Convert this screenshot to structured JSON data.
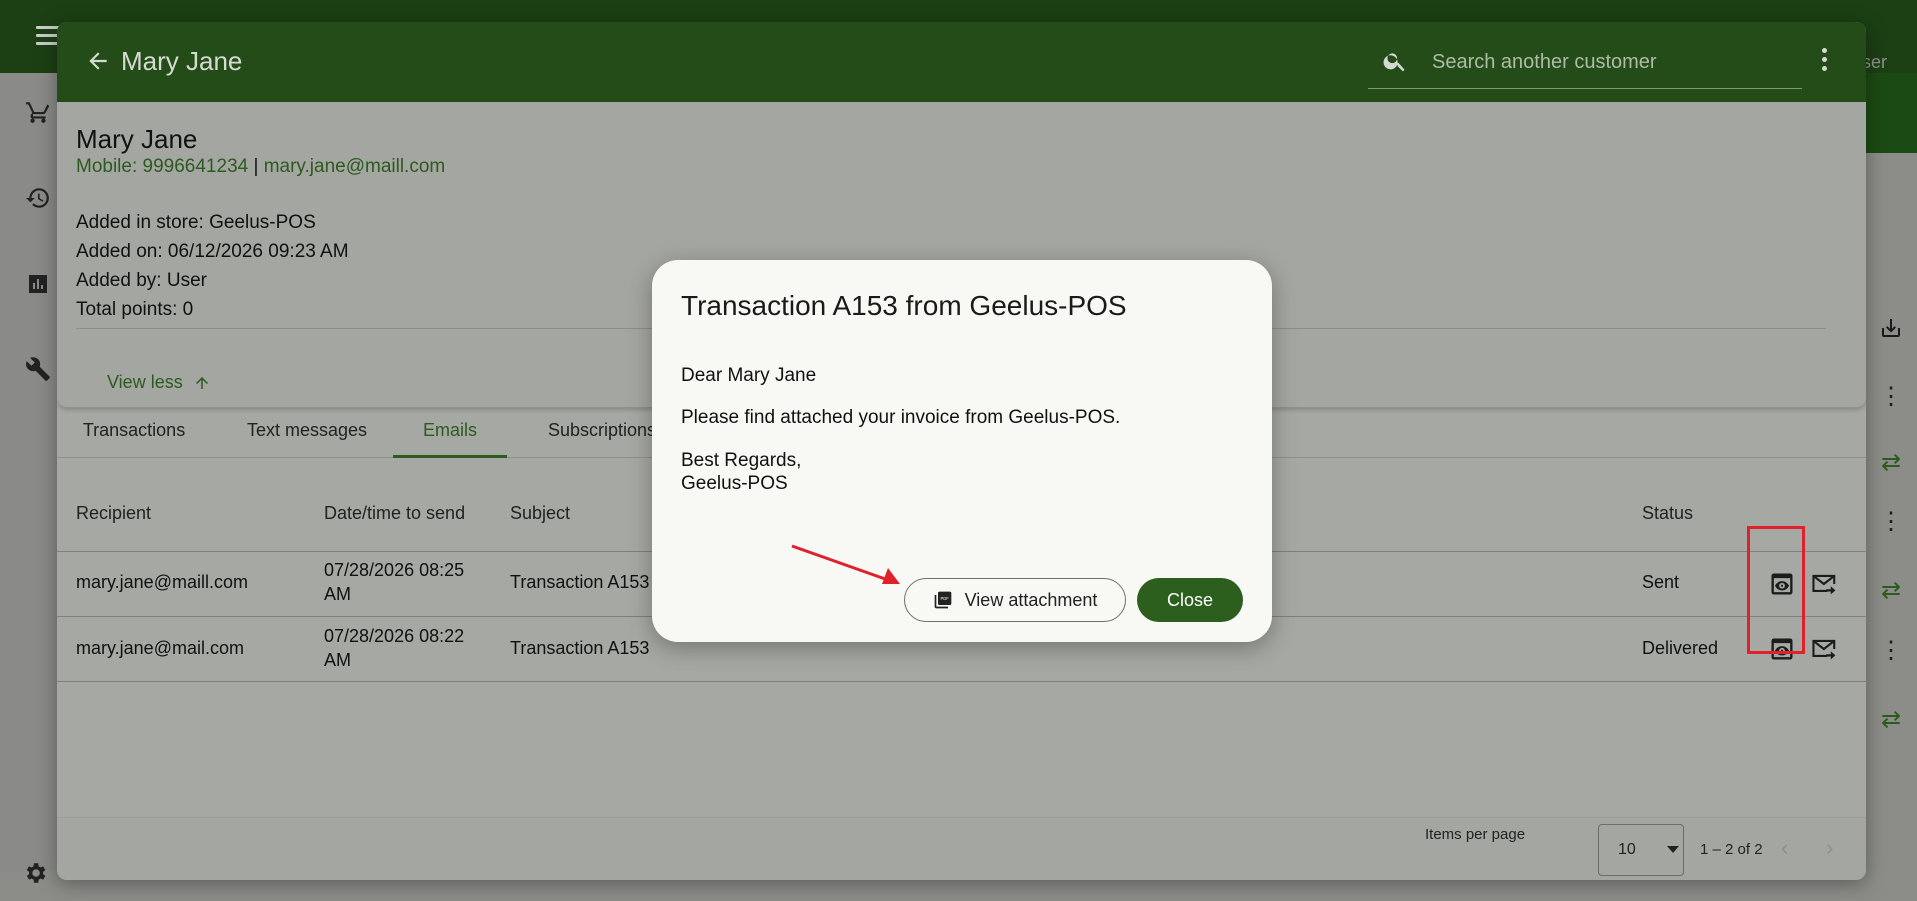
{
  "background": {
    "right_user_label": "ser"
  },
  "panel": {
    "title": "Mary Jane",
    "search_placeholder": "Search another customer"
  },
  "customer": {
    "name": "Mary Jane",
    "mobile": "Mobile: 9996641234",
    "separator": "|",
    "email": "mary.jane@maill.com",
    "added_in_store": "Added in store: Geelus-POS",
    "added_on": "Added on: 06/12/2026 09:23 AM",
    "added_by": "Added by: User",
    "total_points": "Total points: 0",
    "view_less": "View less"
  },
  "tabs": [
    "Transactions",
    "Text messages",
    "Emails",
    "Subscriptions"
  ],
  "active_tab": "Emails",
  "table": {
    "headers": {
      "recipient": "Recipient",
      "datetime": "Date/time to send",
      "subject": "Subject",
      "status": "Status"
    },
    "rows": [
      {
        "recipient": "mary.jane@maill.com",
        "datetime_line1": "07/28/2026 08:25",
        "datetime_line2": "AM",
        "subject": "Transaction A153",
        "status": "Sent"
      },
      {
        "recipient": "mary.jane@mail.com",
        "datetime_line1": "07/28/2026 08:22",
        "datetime_line2": "AM",
        "subject": "Transaction A153",
        "status": "Delivered"
      }
    ]
  },
  "paginator": {
    "items_per_page_label": "Items per page",
    "items_per_page_value": "10",
    "range": "1 – 2 of 2"
  },
  "modal": {
    "title": "Transaction A153 from Geelus-POS",
    "greeting": "Dear Mary Jane",
    "body": "Please find attached your invoice from Geelus-POS.",
    "signoff_line1": "Best Regards,",
    "signoff_line2": "Geelus-POS",
    "view_attachment": "View attachment",
    "close": "Close"
  },
  "colors": {
    "header_green": "#244c18",
    "accent_green": "#2c5f1d",
    "highlight_red": "#e0202a"
  }
}
